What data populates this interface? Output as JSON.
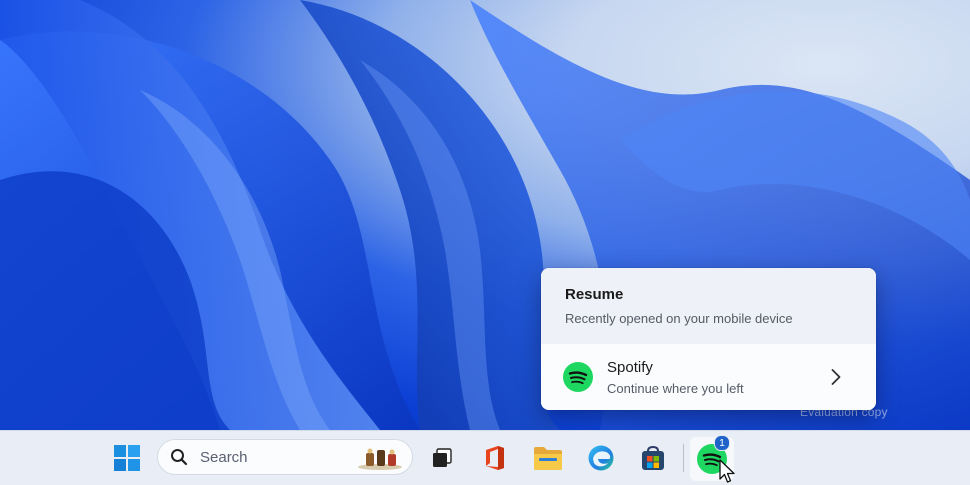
{
  "desktop": {
    "watermark": "Evaluation copy"
  },
  "flyout": {
    "title": "Resume",
    "subtitle": "Recently opened on your mobile device",
    "app": {
      "name": "Spotify",
      "description": "Continue where you left",
      "icon": "spotify-icon"
    }
  },
  "taskbar": {
    "search_label": "Search",
    "badge_count": "1",
    "icons": [
      "windows-start-icon",
      "search-icon",
      "task-view-icon",
      "office-icon",
      "file-explorer-icon",
      "edge-icon",
      "store-icon",
      "spotify-icon"
    ]
  },
  "colors": {
    "spotify_green": "#1ed760",
    "accent_blue": "#1f63c9",
    "taskbar_bg": "#e9eef6"
  }
}
